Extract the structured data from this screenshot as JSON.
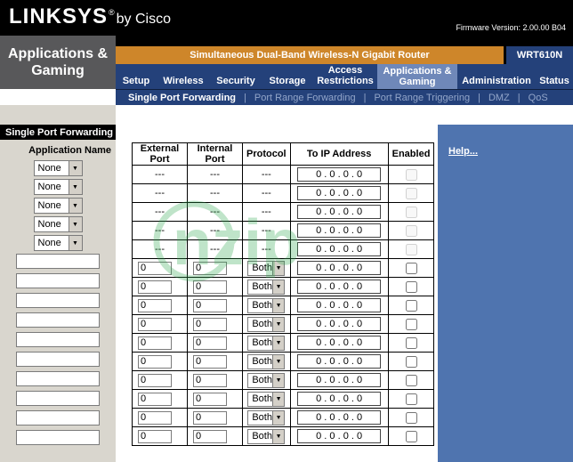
{
  "topbar": {
    "brand": "LINKSYS",
    "reg": "®",
    "brand_suffix": "by Cisco",
    "firmware": "Firmware Version: 2.00.00 B04"
  },
  "header": {
    "section_title": "Applications &\nGaming",
    "router_title": "Simultaneous Dual-Band Wireless-N Gigabit Router",
    "model": "WRT610N",
    "tabs": [
      {
        "label": "Setup",
        "active": false
      },
      {
        "label": "Wireless",
        "active": false
      },
      {
        "label": "Security",
        "active": false
      },
      {
        "label": "Storage",
        "active": false
      },
      {
        "label": "Access\nRestrictions",
        "active": false
      },
      {
        "label": "Applications &\nGaming",
        "active": true
      },
      {
        "label": "Administration",
        "active": false
      },
      {
        "label": "Status",
        "active": false
      }
    ]
  },
  "subnav": {
    "separator": "|",
    "items": [
      {
        "label": "Single Port Forwarding",
        "active": true
      },
      {
        "label": "Port Range Forwarding",
        "active": false
      },
      {
        "label": "Port Range Triggering",
        "active": false
      },
      {
        "label": "DMZ",
        "active": false
      },
      {
        "label": "QoS",
        "active": false
      }
    ]
  },
  "sidebar": {
    "header": "Single Port Forwarding",
    "application_name_label": "Application Name",
    "dropdowns": [
      "None",
      "None",
      "None",
      "None",
      "None"
    ],
    "inputs": [
      "",
      "",
      "",
      "",
      "",
      "",
      "",
      "",
      "",
      ""
    ]
  },
  "table": {
    "headers": [
      "External Port",
      "Internal Port",
      "Protocol",
      "To IP Address",
      "Enabled"
    ],
    "rows": [
      {
        "external": "---",
        "internal": "---",
        "protocol": "---",
        "ip": "0 . 0 . 0 . 0",
        "enabled": false
      },
      {
        "external": "---",
        "internal": "---",
        "protocol": "---",
        "ip": "0 . 0 . 0 . 0",
        "enabled": false
      },
      {
        "external": "---",
        "internal": "---",
        "protocol": "---",
        "ip": "0 . 0 . 0 . 0",
        "enabled": false
      },
      {
        "external": "---",
        "internal": "---",
        "protocol": "---",
        "ip": "0 . 0 . 0 . 0",
        "enabled": false
      },
      {
        "external": "---",
        "internal": "---",
        "protocol": "---",
        "ip": "0 . 0 . 0 . 0",
        "enabled": false
      },
      {
        "external": "0",
        "internal": "0",
        "protocol": "Both",
        "ip": "0 . 0 . 0 . 0",
        "enabled": false
      },
      {
        "external": "0",
        "internal": "0",
        "protocol": "Both",
        "ip": "0 . 0 . 0 . 0",
        "enabled": false
      },
      {
        "external": "0",
        "internal": "0",
        "protocol": "Both",
        "ip": "0 . 0 . 0 . 0",
        "enabled": false
      },
      {
        "external": "0",
        "internal": "0",
        "protocol": "Both",
        "ip": "0 . 0 . 0 . 0",
        "enabled": false
      },
      {
        "external": "0",
        "internal": "0",
        "protocol": "Both",
        "ip": "0 . 0 . 0 . 0",
        "enabled": false
      },
      {
        "external": "0",
        "internal": "0",
        "protocol": "Both",
        "ip": "0 . 0 . 0 . 0",
        "enabled": false
      },
      {
        "external": "0",
        "internal": "0",
        "protocol": "Both",
        "ip": "0 . 0 . 0 . 0",
        "enabled": false
      },
      {
        "external": "0",
        "internal": "0",
        "protocol": "Both",
        "ip": "0 . 0 . 0 . 0",
        "enabled": false
      },
      {
        "external": "0",
        "internal": "0",
        "protocol": "Both",
        "ip": "0 . 0 . 0 . 0",
        "enabled": false
      },
      {
        "external": "0",
        "internal": "0",
        "protocol": "Both",
        "ip": "0 . 0 . 0 . 0",
        "enabled": false
      }
    ]
  },
  "help": {
    "label": "Help..."
  },
  "watermark": {
    "text": "nzip"
  },
  "colors": {
    "accent_orange": "#CE862A",
    "nav_blue": "#24417A",
    "active_tab_blue": "#6F88B9",
    "help_panel_blue": "#4F74AF",
    "sidebar_gray": "#D9D6CE",
    "watermark_green": "#2FA84F"
  }
}
